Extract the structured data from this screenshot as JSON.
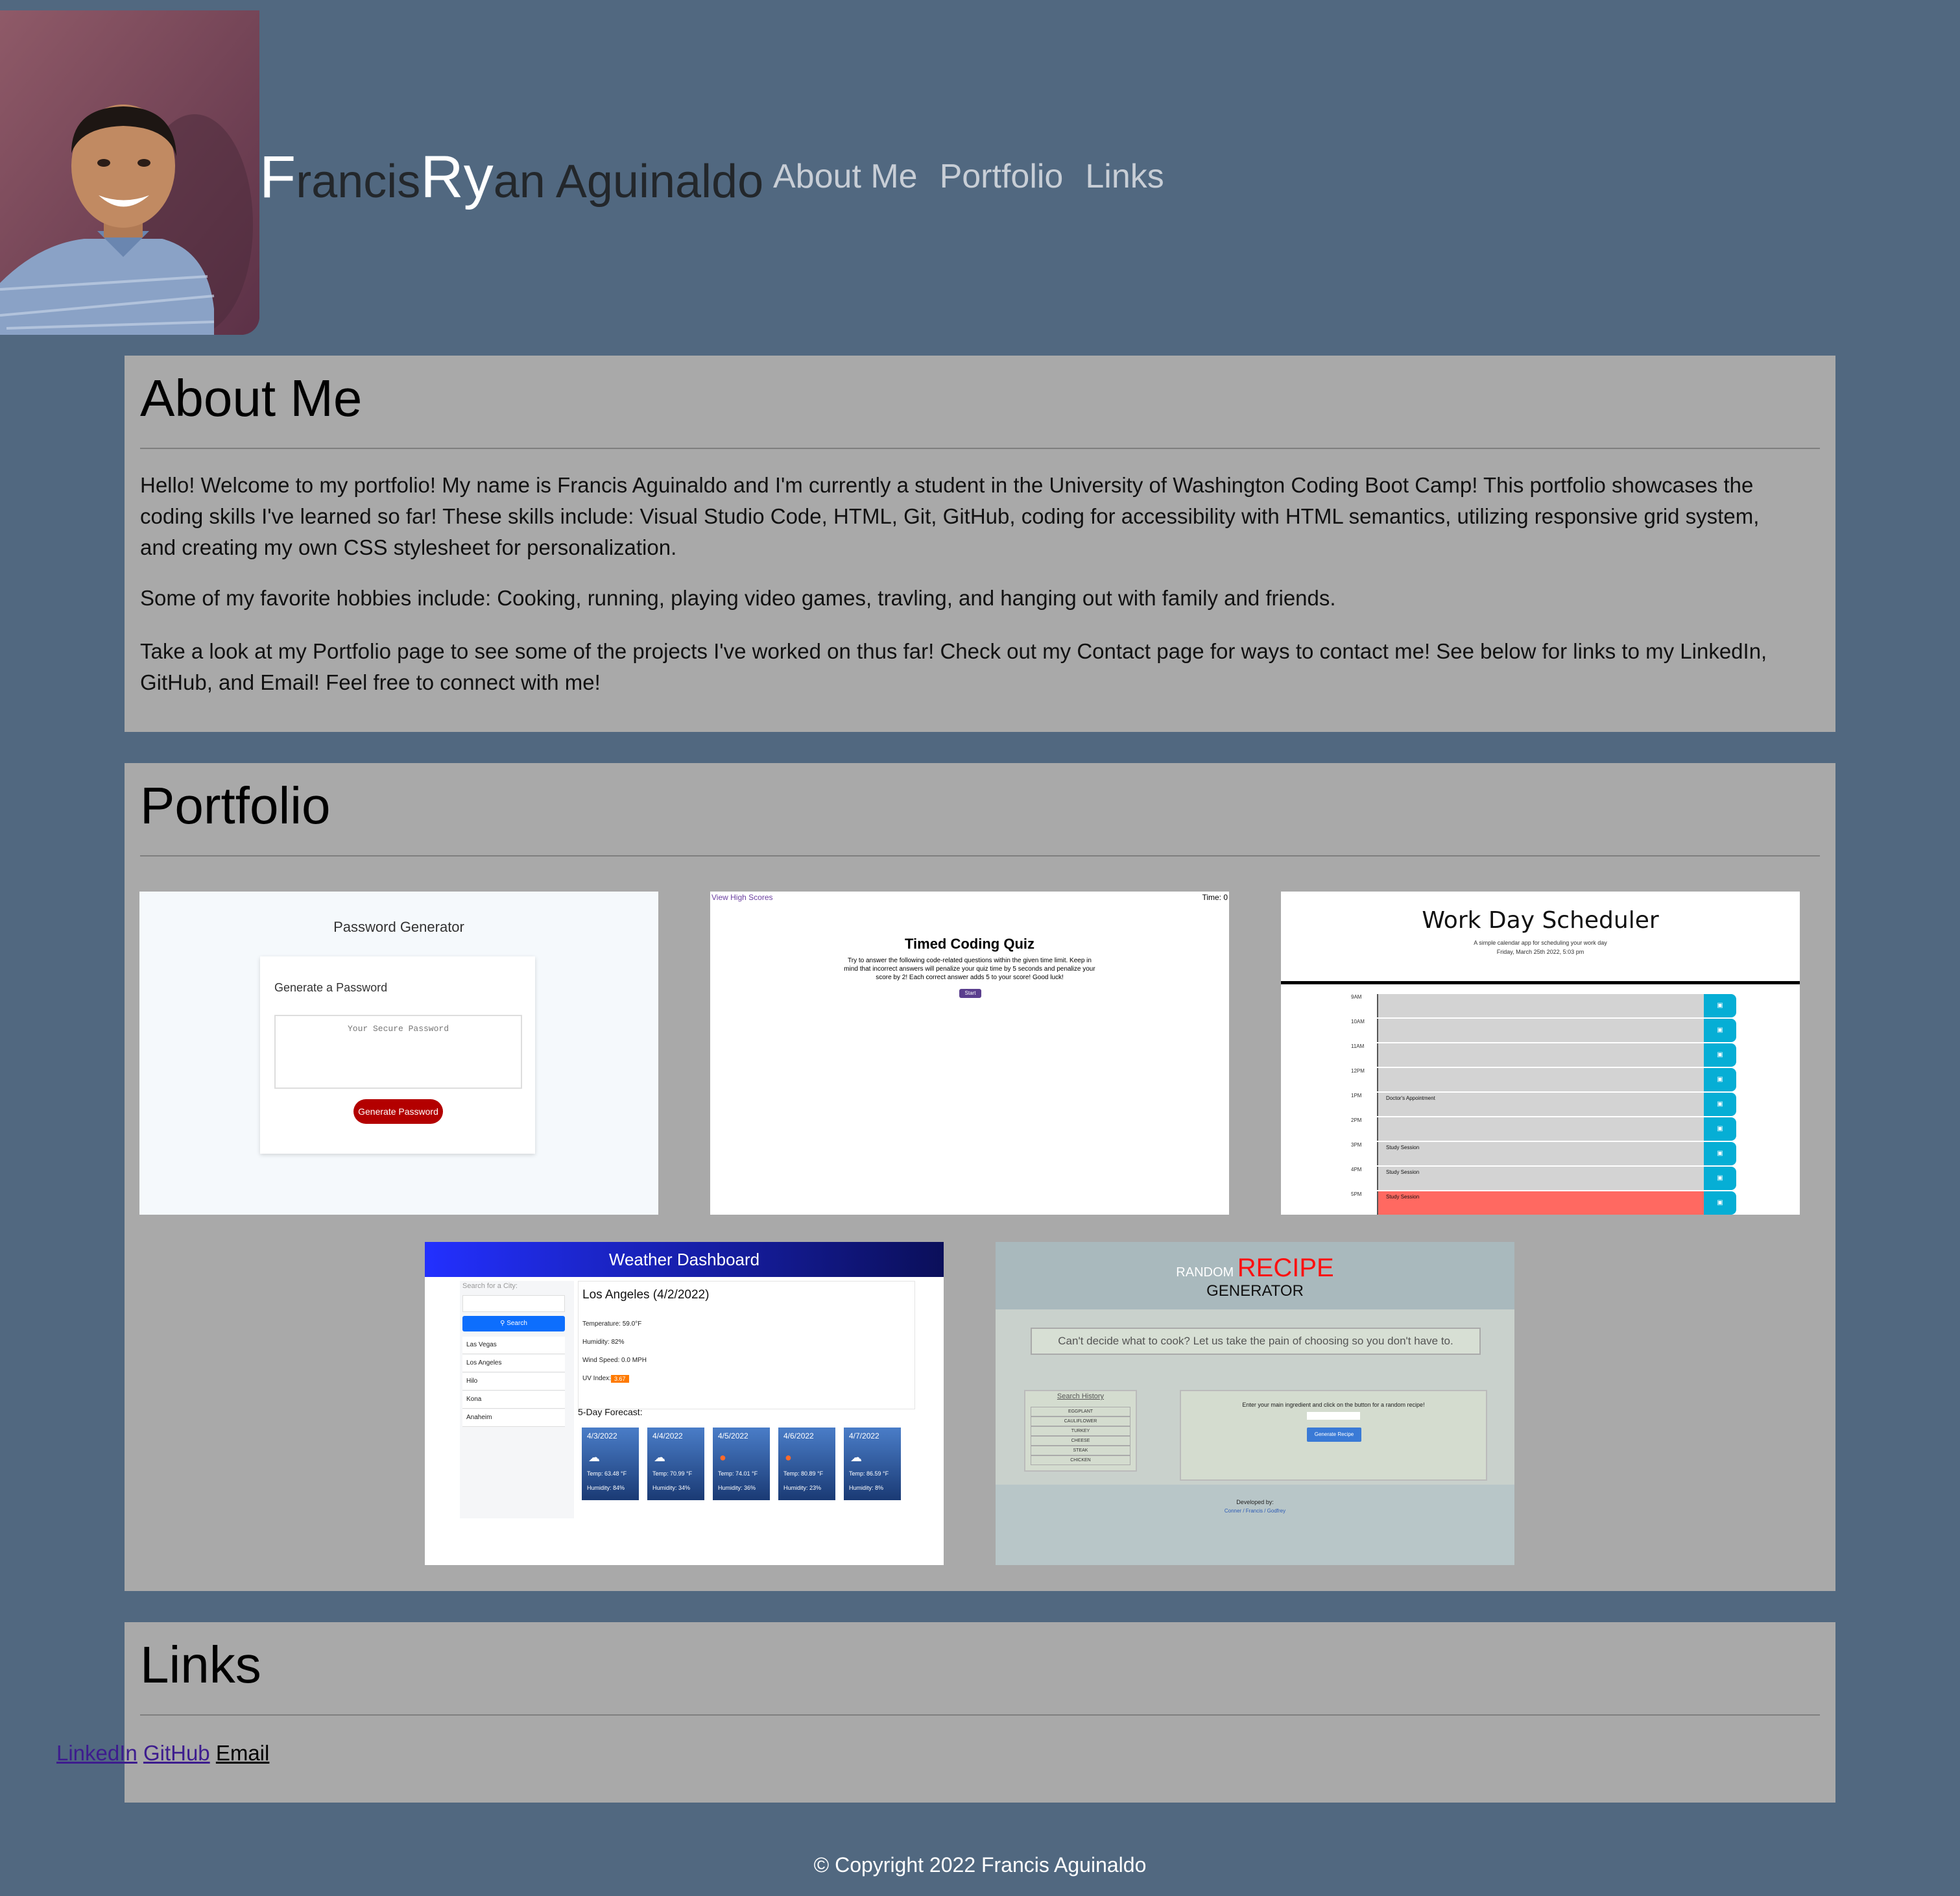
{
  "header": {
    "name_parts": [
      {
        "text": "F",
        "cap": true
      },
      {
        "text": "rancis",
        "cap": false
      },
      {
        "text": "R",
        "cap": true
      },
      {
        "text": "y",
        "cap": true
      },
      {
        "text": "an Aguinaldo",
        "cap": false
      }
    ],
    "nav": [
      "About Me",
      "Portfolio",
      "Links"
    ]
  },
  "about": {
    "title": "About Me",
    "paragraphs": [
      "Hello! Welcome to my portfolio! My name is Francis Aguinaldo and I'm currently a student in the University of Washington Coding Boot Camp! This portfolio showcases the coding skills I've learned so far! These skills include: Visual Studio Code, HTML, Git, GitHub, coding for accessibility with HTML semantics, utilizing responsive grid system, and creating my own CSS stylesheet for personalization.",
      "Some of my favorite hobbies include: Cooking, running, playing video games, travling, and hanging out with family and friends.",
      "Take a look at my Portfolio page to see some of the projects I've worked on thus far! Check out my Contact page for ways to contact me! See below for links to my LinkedIn, GitHub, and Email! Feel free to connect with me!"
    ]
  },
  "portfolio": {
    "title": "Portfolio",
    "password": {
      "title": "Password Generator",
      "card_label": "Generate a Password",
      "placeholder": "Your Secure Password",
      "button": "Generate Password"
    },
    "quiz": {
      "high_scores": "View High Scores",
      "time": "Time: 0",
      "title": "Timed Coding Quiz",
      "desc": "Try to answer the following code-related questions within the given time limit. Keep in mind that incorrect answers will penalize your quiz time by 5 seconds and penalize your score by 2! Each correct answer adds 5 to your score! Good luck!",
      "button": "Start Quiz"
    },
    "scheduler": {
      "title": "Work Day Scheduler",
      "subtitle": "A simple calendar app for scheduling your work day",
      "date": "Friday, March 25th 2022, 5:03 pm",
      "rows": [
        {
          "hour": "9AM",
          "text": "",
          "state": "past"
        },
        {
          "hour": "10AM",
          "text": "",
          "state": "past"
        },
        {
          "hour": "11AM",
          "text": "",
          "state": "past"
        },
        {
          "hour": "12PM",
          "text": "",
          "state": "past"
        },
        {
          "hour": "1PM",
          "text": "Doctor's Appointment",
          "state": "past"
        },
        {
          "hour": "2PM",
          "text": "",
          "state": "past"
        },
        {
          "hour": "3PM",
          "text": "Study Session",
          "state": "past"
        },
        {
          "hour": "4PM",
          "text": "Study Session",
          "state": "past"
        },
        {
          "hour": "5PM",
          "text": "Study Session",
          "state": "present"
        }
      ]
    },
    "weather": {
      "header": "Weather Dashboard",
      "search_label": "Search for a City:",
      "search_button": "Search",
      "cities": [
        "Las Vegas",
        "Los Angeles",
        "Hilo",
        "Kona",
        "Anaheim"
      ],
      "current_city": "Los Angeles (4/2/2022)",
      "stats": [
        "Temperature: 59.0°F",
        "Humidity: 82%",
        "Wind Speed: 0.0 MPH",
        "UV Index:"
      ],
      "uv": "3.67",
      "forecast_label": "5-Day Forecast:",
      "forecast": [
        {
          "date": "4/3/2022",
          "icon": "☁",
          "temp": "Temp: 63.48 °F",
          "hum": "Humidity: 84%"
        },
        {
          "date": "4/4/2022",
          "icon": "☁",
          "temp": "Temp: 70.99 °F",
          "hum": "Humidity: 34%"
        },
        {
          "date": "4/5/2022",
          "icon": "●",
          "temp": "Temp: 74.01 °F",
          "hum": "Humidity: 36%"
        },
        {
          "date": "4/6/2022",
          "icon": "●",
          "temp": "Temp: 80.89 °F",
          "hum": "Humidity: 23%"
        },
        {
          "date": "4/7/2022",
          "icon": "☁",
          "temp": "Temp: 86.59 °F",
          "hum": "Humidity: 8%"
        }
      ]
    },
    "recipe": {
      "random": "RANDOM",
      "recipe": "RECIPE",
      "generator": "GENERATOR",
      "tagline": "Can't decide what to cook? Let us take the pain of choosing so you don't have to.",
      "history_title": "Search History",
      "history": [
        "EGGPLANT",
        "CAULIFLOWER",
        "TURKEY",
        "CHEESE",
        "STEAK",
        "CHICKEN"
      ],
      "instruction": "Enter your main ingredient and click on the button for a random recipe!",
      "button": "Generate Recipe",
      "developed_by": "Developed by:",
      "devs": "Conner / Francis / Godfrey"
    }
  },
  "links": {
    "title": "Links",
    "items": [
      {
        "label": "LinkedIn",
        "color": "#3d1c8e"
      },
      {
        "label": "GitHub",
        "color": "#3d1c8e"
      },
      {
        "label": "Email",
        "color": "#000000"
      }
    ]
  },
  "footer": "© Copyright 2022 Francis Aguinaldo"
}
